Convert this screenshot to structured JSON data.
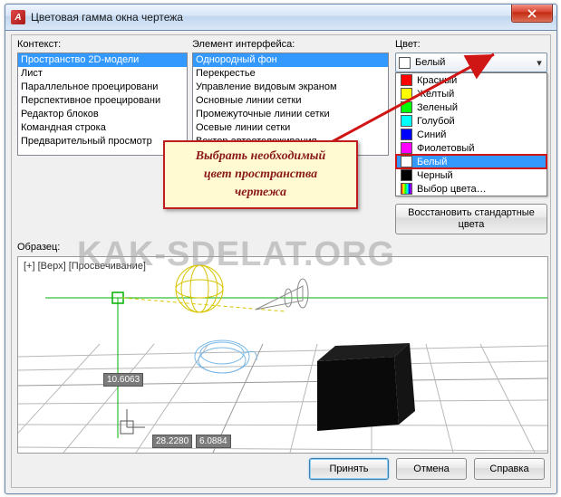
{
  "window": {
    "title": "Цветовая гамма окна чертежа"
  },
  "labels": {
    "context": "Контекст:",
    "element": "Элемент интерфейса:",
    "color": "Цвет:",
    "sample": "Образец:"
  },
  "contextList": {
    "items": [
      "Пространство 2D-модели",
      "Лист",
      "Параллельное проецировани",
      "Перспективное проецировани",
      "Редактор блоков",
      "Командная строка",
      "Предварительный просмотр"
    ],
    "selected": 0
  },
  "elementList": {
    "items": [
      "Однородный фон",
      "Перекрестье",
      "Управление видовым экраном",
      "Основные линии сетки",
      "Промежуточные линии сетки",
      "Осевые линии сетки",
      "Вектор автоотслеживания"
    ],
    "selected": 0
  },
  "colorCombo": {
    "swatch": "#ffffff",
    "text": "Белый"
  },
  "colorDropdown": {
    "items": [
      {
        "swatch": "#ff0000",
        "label": "Красный"
      },
      {
        "swatch": "#ffff00",
        "label": "Желтый"
      },
      {
        "swatch": "#00ff00",
        "label": "Зеленый"
      },
      {
        "swatch": "#00ffff",
        "label": "Голубой"
      },
      {
        "swatch": "#0000ff",
        "label": "Синий"
      },
      {
        "swatch": "#ff00ff",
        "label": "Фиолетовый"
      },
      {
        "swatch": "#ffffff",
        "label": "Белый"
      },
      {
        "swatch": "#000000",
        "label": "Черный"
      },
      {
        "swatch": "gradient",
        "label": "Выбор цвета…"
      }
    ],
    "highlighted": 6
  },
  "restoreBtn": "Восстановить стандартные\nцвета",
  "buttons": {
    "ok": "Принять",
    "cancel": "Отмена",
    "help": "Справка"
  },
  "callout": {
    "l1": "Выбрать необходимый",
    "l2": "цвет пространства",
    "l3": "чертежа"
  },
  "preview": {
    "viewport": "[+] [Верх] [Просвечивание]",
    "m1": "10.6063",
    "m2": "28.2280",
    "m3": "6.0884"
  },
  "watermark": "KAK-SDELAT.ORG"
}
